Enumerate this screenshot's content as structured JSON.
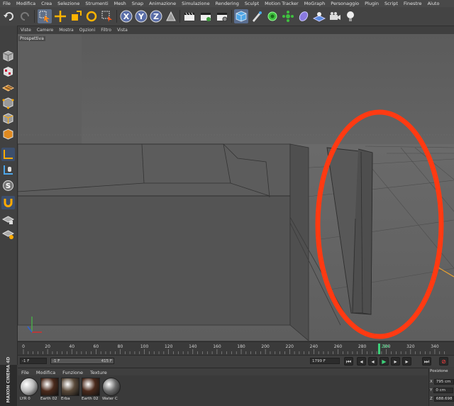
{
  "menu": [
    "File",
    "Modifica",
    "Crea",
    "Selezione",
    "Strumenti",
    "Mesh",
    "Snap",
    "Animazione",
    "Simulazione",
    "Rendering",
    "Sculpt",
    "Motion Tracker",
    "MoGraph",
    "Personaggio",
    "Plugin",
    "Script",
    "Finestre",
    "Aiuto"
  ],
  "toolbar": {
    "icons": [
      "undo-icon",
      "redo-icon",
      "select-arrow-icon",
      "move-icon",
      "scale-icon",
      "rotate-icon",
      "recent-tool-icon",
      "x-axis-icon",
      "y-axis-icon",
      "z-axis-icon",
      "coordinate-system-icon",
      "render-view-icon",
      "render-picture-viewer-icon",
      "edit-render-settings-icon",
      "cube-icon",
      "pen-spline-icon",
      "subdivision-icon",
      "array-icon",
      "deformer-icon",
      "scene-floor-icon",
      "camera-icon",
      "light-icon"
    ],
    "axis_letters": [
      "X",
      "Y",
      "Z"
    ]
  },
  "palette": {
    "icons": [
      "make-editable-icon",
      "model-mode-icon",
      "texture-mode-icon",
      "workplane-icon",
      "points-mode-icon",
      "edges-mode-icon",
      "polygons-mode-icon",
      "axis-icon",
      "tweak-icon",
      "solo-icon",
      "snap-magnet-icon",
      "locked-workplane-icon",
      "planar-workplane-icon"
    ],
    "solo_letter": "S"
  },
  "viewport": {
    "menu": [
      "Viste",
      "Camere",
      "Mostra",
      "Opzioni",
      "Filtro",
      "Vista"
    ],
    "label": "Prospettiva"
  },
  "timeline": {
    "ticks": [
      "0",
      "20",
      "40",
      "60",
      "80",
      "100",
      "120",
      "140",
      "160",
      "180",
      "200",
      "220",
      "240",
      "260",
      "280",
      "300",
      "320",
      "340"
    ],
    "current_frame_label": "294",
    "current_frame": 294,
    "max_frame": 350,
    "accent_color": "#3dd17a"
  },
  "transport": {
    "start_field": "-1 F",
    "range_start": "-1 F",
    "range_end": "415 F",
    "end_field": "1799 F"
  },
  "materials": {
    "menu": [
      "File",
      "Modifica",
      "Funzione",
      "Texture"
    ],
    "items": [
      {
        "name": "LYR 0",
        "color": "#b8b8b8"
      },
      {
        "name": "Earth 02",
        "color": "#4a2a1c"
      },
      {
        "name": "Erba",
        "color": "#5a4a3a"
      },
      {
        "name": "Earth 02",
        "color": "#4a2a1c"
      },
      {
        "name": "Water C",
        "color": "#6a6a6a"
      }
    ]
  },
  "brand": "MAXON CINEMA 4D",
  "coords": {
    "title": "Posizione",
    "x_label": "X",
    "x_value": "795 cm",
    "y_label": "Y",
    "y_value": "0 cm",
    "z_label": "Z",
    "z_value": "688.698"
  },
  "annotation_color": "#ff3a12"
}
